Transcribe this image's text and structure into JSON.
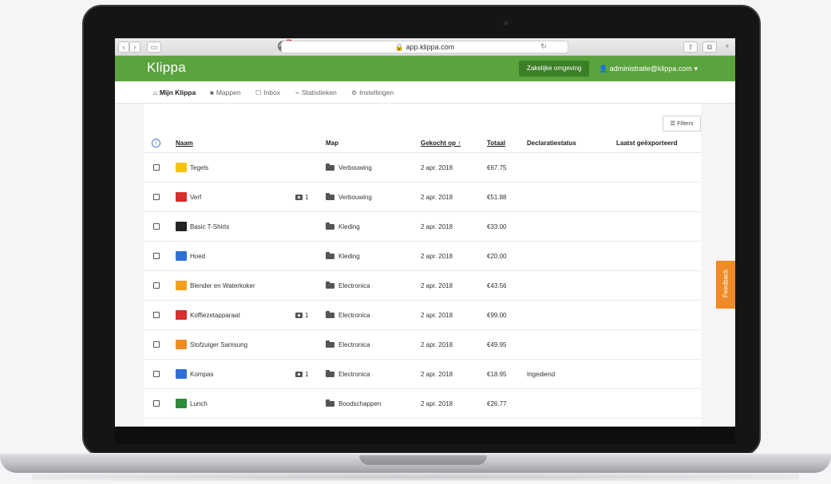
{
  "browser": {
    "url": "app.klippa.com",
    "ext_badge": "ABP",
    "ext_count": "5"
  },
  "header": {
    "logo": "Klippa",
    "env_button": "Zakelijke omgeving",
    "user_email": "administratie@klippa.com",
    "accent_color": "#5aa33d"
  },
  "nav": [
    {
      "icon": "home-icon",
      "glyph": "⌂",
      "label": "Mijn Klippa"
    },
    {
      "icon": "folder-icon",
      "glyph": "■",
      "label": "Mappen"
    },
    {
      "icon": "inbox-icon",
      "glyph": "☐",
      "label": "Inbox"
    },
    {
      "icon": "chart-icon",
      "glyph": "⌁",
      "label": "Statistieken"
    },
    {
      "icon": "gear-icon",
      "glyph": "⚙",
      "label": "Instellingen"
    }
  ],
  "toolbar": {
    "filters_label": "Filters"
  },
  "table": {
    "columns": [
      "Naam",
      "Map",
      "Gekocht op ↑",
      "Totaal",
      "Declaratiestatus",
      "Laatst geëxporteerd"
    ],
    "rows": [
      {
        "name": "Tegels",
        "attachments": "",
        "folder": "Verbouwing",
        "date": "2 apr. 2018",
        "total": "€67.75",
        "status": "",
        "exported": "",
        "logo_color": "#f5c400"
      },
      {
        "name": "Verf",
        "attachments": "1",
        "folder": "Verbouwing",
        "date": "2 apr. 2018",
        "total": "€51.88",
        "status": "",
        "exported": "",
        "logo_color": "#d62d2d"
      },
      {
        "name": "Basic T-Shirts",
        "attachments": "",
        "folder": "Kleding",
        "date": "2 apr. 2018",
        "total": "€33.00",
        "status": "",
        "exported": "",
        "logo_color": "#222222"
      },
      {
        "name": "Hoed",
        "attachments": "",
        "folder": "Kleding",
        "date": "2 apr. 2018",
        "total": "€20.00",
        "status": "",
        "exported": "",
        "logo_color": "#2f6fd6"
      },
      {
        "name": "Blender en Waterkoker",
        "attachments": "",
        "folder": "Electronica",
        "date": "2 apr. 2018",
        "total": "€43.56",
        "status": "",
        "exported": "",
        "logo_color": "#f2a21a"
      },
      {
        "name": "Koffiezetapparaat",
        "attachments": "1",
        "folder": "Electronica",
        "date": "2 apr. 2018",
        "total": "€99.00",
        "status": "",
        "exported": "",
        "logo_color": "#d62d2d"
      },
      {
        "name": "Stofzuiger Samsung",
        "attachments": "",
        "folder": "Electronica",
        "date": "2 apr. 2018",
        "total": "€49.95",
        "status": "",
        "exported": "",
        "logo_color": "#f08a24"
      },
      {
        "name": "Kompas",
        "attachments": "1",
        "folder": "Electronica",
        "date": "2 apr. 2018",
        "total": "€18.95",
        "status": "Ingediend",
        "exported": "",
        "logo_color": "#2f6fd6"
      },
      {
        "name": "Lunch",
        "attachments": "",
        "folder": "Boodschappen",
        "date": "2 apr. 2018",
        "total": "€26.77",
        "status": "",
        "exported": "",
        "logo_color": "#2e8b3a"
      }
    ]
  },
  "feedback_label": "Feedback",
  "fab_label": "+"
}
